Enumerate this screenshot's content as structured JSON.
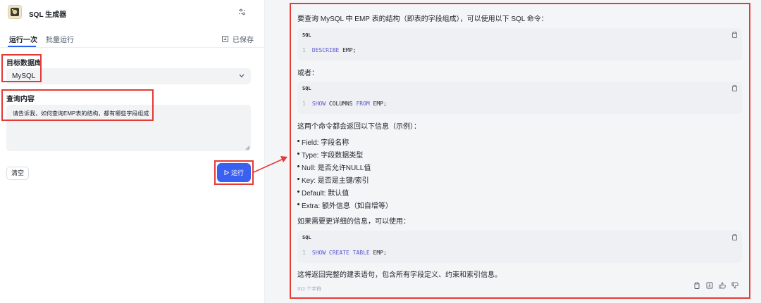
{
  "app": {
    "title": "SQL 生成器"
  },
  "tabs": [
    {
      "label": "运行一次",
      "active": true
    },
    {
      "label": "批量运行",
      "active": false
    }
  ],
  "saved_label": "已保存",
  "form": {
    "db_label": "目标数据库",
    "db_value": "MySQL",
    "query_label": "查询内容",
    "query_value": "请告诉我，如何查询EMP表的结构，都有哪些字段组成",
    "clear_label": "清空",
    "run_label": "运行"
  },
  "result": {
    "intro": "要查询 MySQL 中 EMP 表的结构（即表的字段组成），可以使用以下 SQL 命令：",
    "code1": {
      "lang": "SQL",
      "line_no": "1",
      "keyword": "DESCRIBE",
      "rest": " EMP;"
    },
    "or_text": "或者：",
    "code2": {
      "lang": "SQL",
      "line_no": "1",
      "kw1": "SHOW",
      "mid": " COLUMNS ",
      "kw2": "FROM",
      "rest": " EMP;"
    },
    "both_return": "这两个命令都会返回以下信息（示例）：",
    "bullets": [
      "Field: 字段名称",
      "Type: 字段数据类型",
      "Null: 是否允许NULL值",
      "Key: 是否是主键/索引",
      "Default: 默认值",
      "Extra: 额外信息（如自增等）"
    ],
    "more_detail": "如果需要更详细的信息，可以使用：",
    "code3": {
      "lang": "SQL",
      "line_no": "1",
      "keyword": "SHOW CREATE TABLE",
      "rest": " EMP;"
    },
    "closing": "这将返回完整的建表语句，包含所有字段定义、约束和索引信息。",
    "char_count": "311 个字符"
  },
  "colors": {
    "accent": "#3a60f2",
    "annotation": "#e53935",
    "keyword": "#5b57d1"
  }
}
